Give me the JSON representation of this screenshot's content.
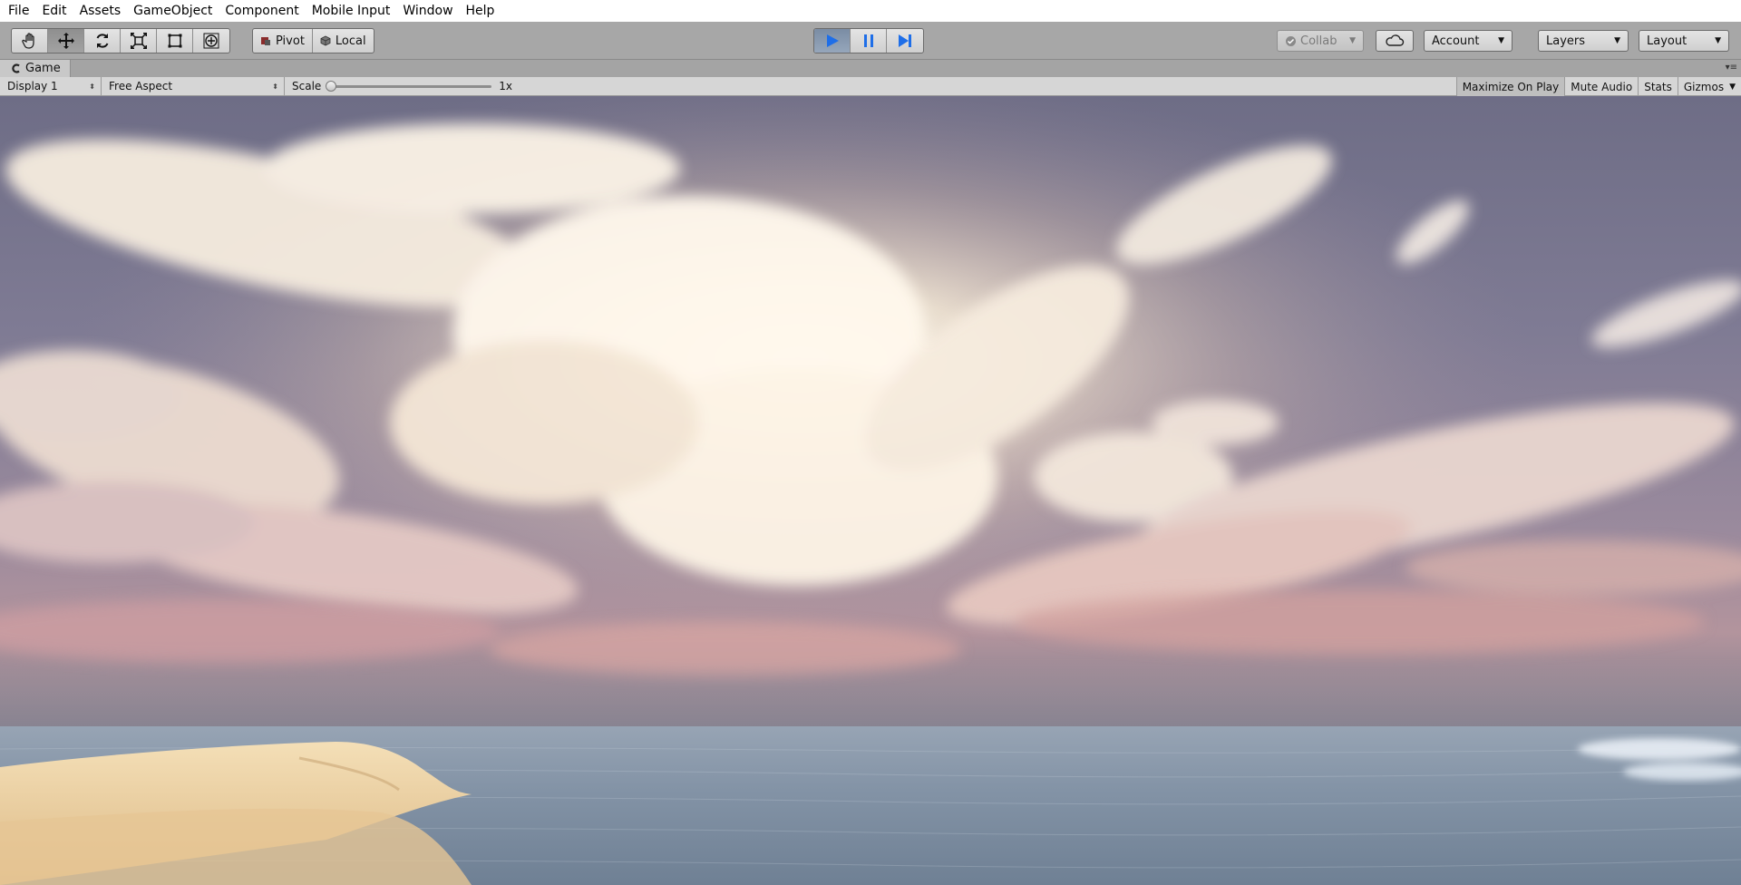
{
  "menu": {
    "items": [
      "File",
      "Edit",
      "Assets",
      "GameObject",
      "Component",
      "Mobile Input",
      "Window",
      "Help"
    ]
  },
  "toolbar": {
    "tools": [
      {
        "icon": "hand-tool-icon",
        "active": false
      },
      {
        "icon": "move-tool-icon",
        "active": true
      },
      {
        "icon": "rotate-tool-icon",
        "active": false
      },
      {
        "icon": "scale-tool-icon",
        "active": false
      },
      {
        "icon": "rect-tool-icon",
        "active": false
      },
      {
        "icon": "transform-tool-icon",
        "active": false
      }
    ],
    "pivot_label": "Pivot",
    "local_label": "Local",
    "play_active": true,
    "collab_label": "Collab",
    "account_label": "Account",
    "layers_label": "Layers",
    "layout_label": "Layout"
  },
  "game_tab": {
    "title": "Game"
  },
  "game_view": {
    "display": "Display 1",
    "aspect": "Free Aspect",
    "scale_label": "Scale",
    "scale_value": "1x",
    "scale_fraction": 0,
    "maximize_on_play": "Maximize On Play",
    "mute_audio": "Mute Audio",
    "stats": "Stats",
    "gizmos": "Gizmos"
  },
  "colors": {
    "play_accent": "#1e6ee8",
    "sky_top": "#6e6d86",
    "horizon": "#b3949d",
    "water": "#7f8fa2",
    "sand": "#ecd2a4"
  }
}
